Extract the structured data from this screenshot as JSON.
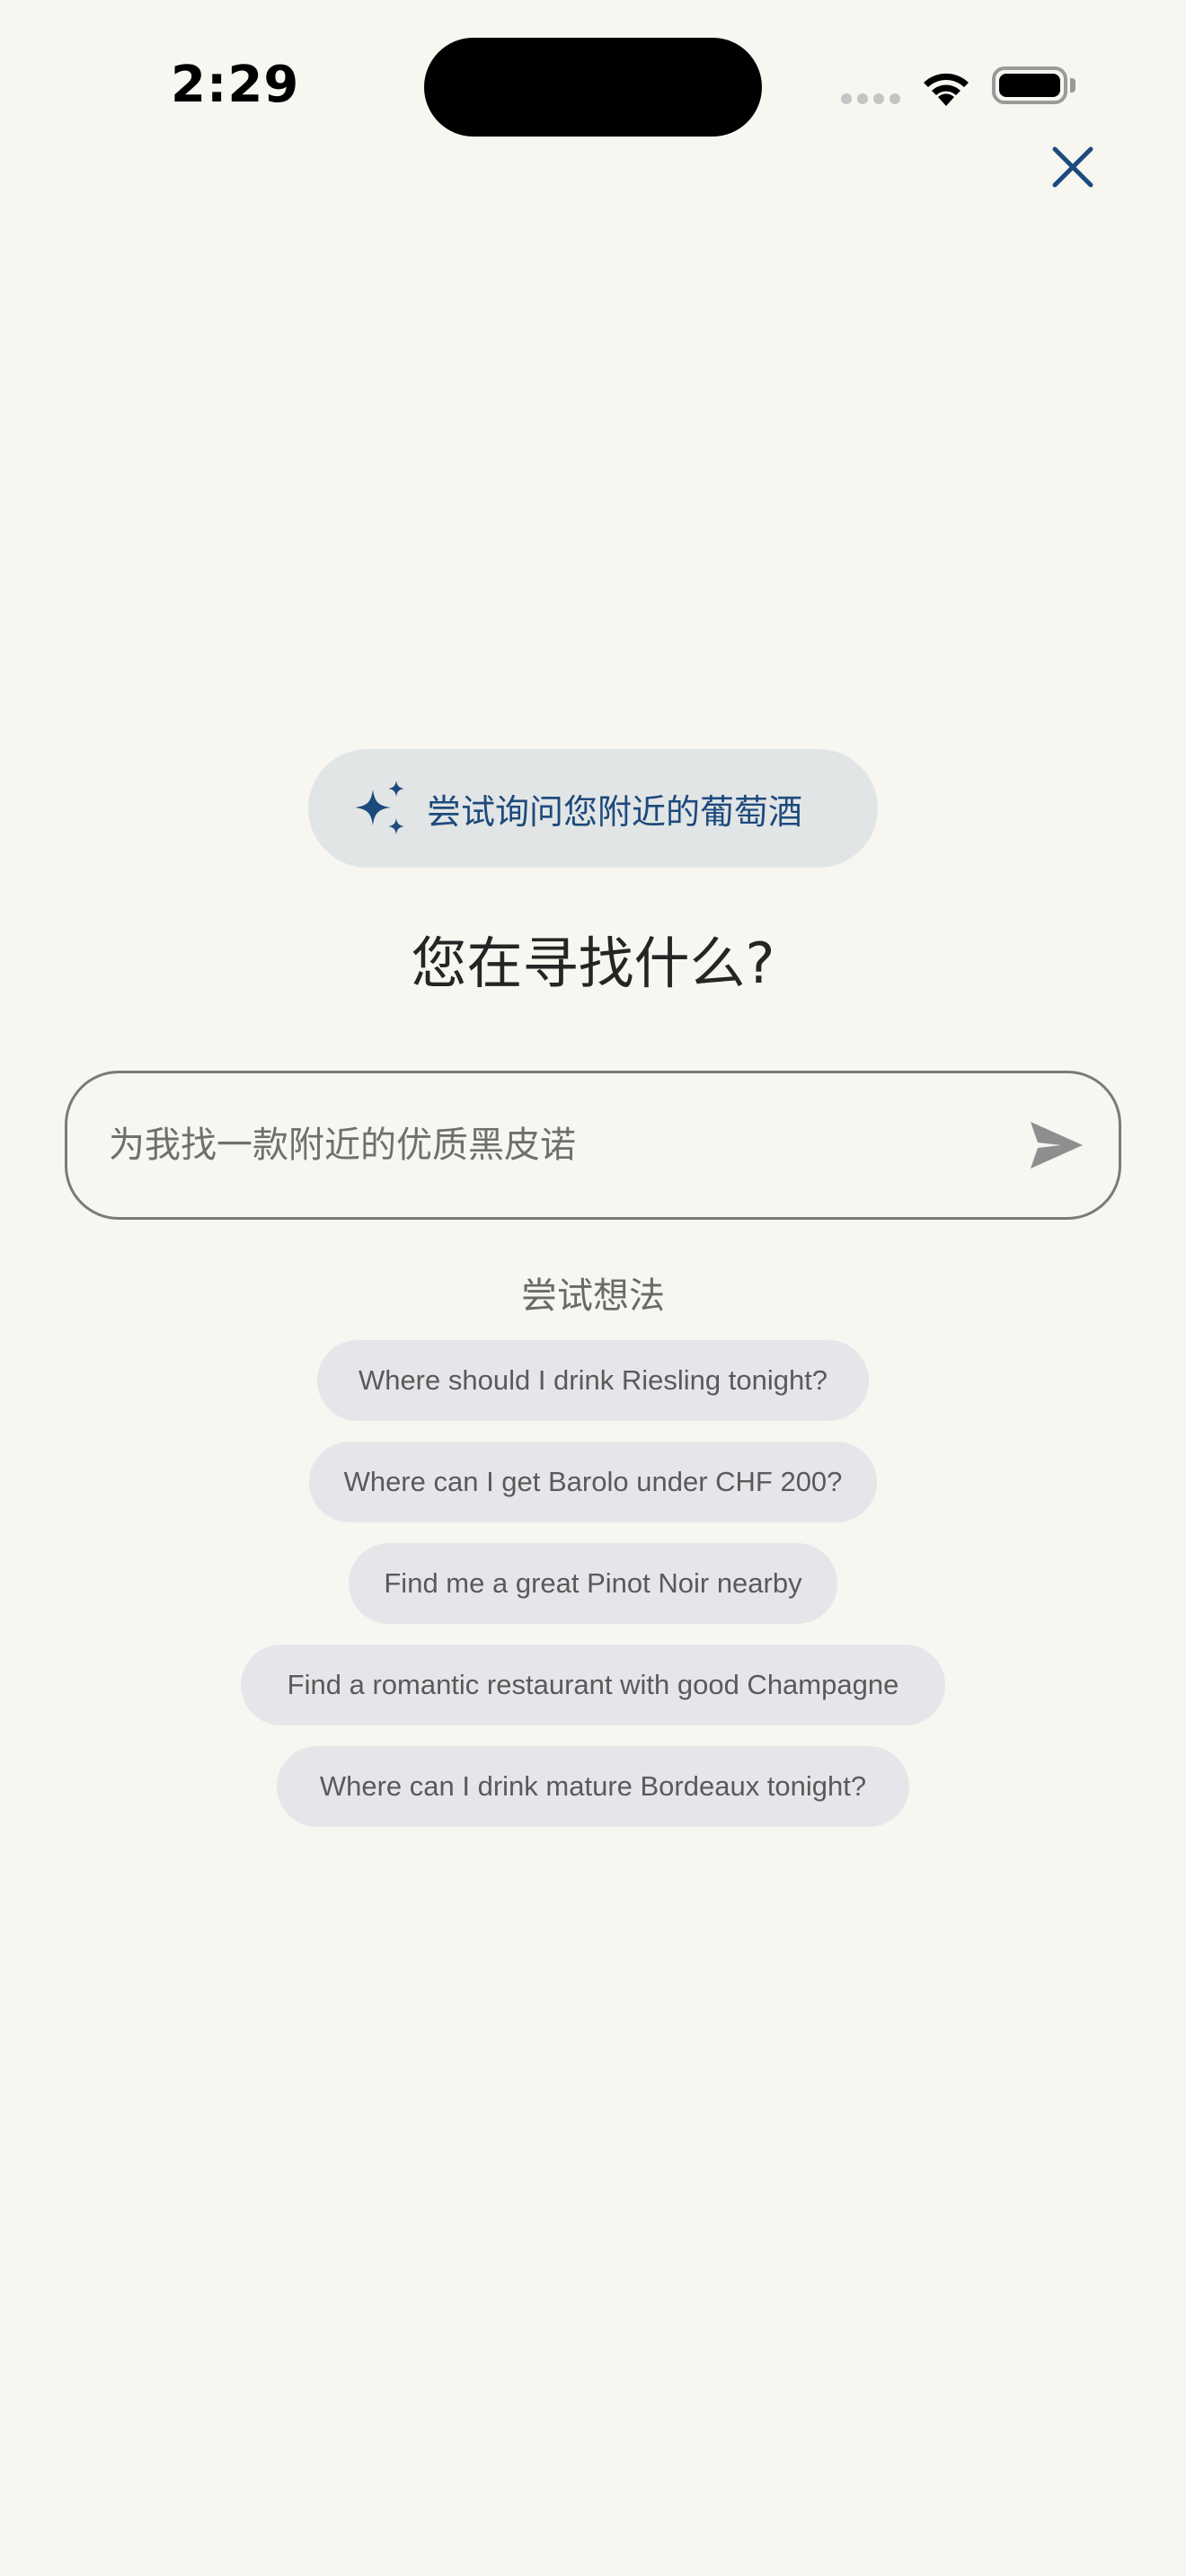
{
  "status_bar": {
    "time": "2:29"
  },
  "hint": {
    "icon": "sparkles-icon",
    "text": "尝试询问您附近的葡萄酒",
    "color": "#1d4a7d"
  },
  "title": "您在寻找什么?",
  "search": {
    "placeholder": "为我找一款附近的优质黑皮诺",
    "value": ""
  },
  "ideas": {
    "label": "尝试想法",
    "items": [
      "Where should I drink Riesling tonight?",
      "Where can I get Barolo under CHF 200?",
      "Find me a great Pinot Noir nearby",
      "Find a romantic restaurant with good Champagne",
      "Where can I drink mature Bordeaux tonight?"
    ]
  },
  "colors": {
    "background": "#f7f6f1",
    "accent": "#1d4a7d",
    "chip_background": "#e8e5ea"
  }
}
